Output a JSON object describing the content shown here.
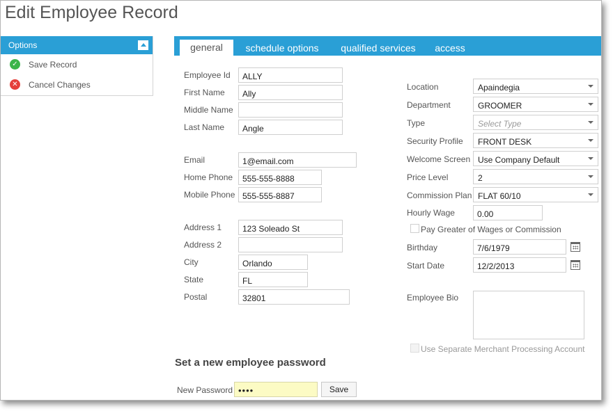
{
  "page": {
    "title": "Edit Employee Record"
  },
  "sidebar": {
    "header": "Options",
    "items": [
      {
        "label": "Save Record",
        "icon": "check-circle-icon"
      },
      {
        "label": "Cancel Changes",
        "icon": "x-circle-icon"
      }
    ]
  },
  "tabs": [
    {
      "label": "general",
      "active": true
    },
    {
      "label": "schedule options",
      "active": false
    },
    {
      "label": "qualified services",
      "active": false
    },
    {
      "label": "access",
      "active": false
    }
  ],
  "form": {
    "employee_id": {
      "label": "Employee Id",
      "value": "ALLY"
    },
    "first_name": {
      "label": "First Name",
      "value": "Ally"
    },
    "middle_name": {
      "label": "Middle Name",
      "value": ""
    },
    "last_name": {
      "label": "Last Name",
      "value": "Angle"
    },
    "email": {
      "label": "Email",
      "value": "1@email.com"
    },
    "home_phone": {
      "label": "Home Phone",
      "value": "555-555-8888"
    },
    "mobile_phone": {
      "label": "Mobile Phone",
      "value": "555-555-8887"
    },
    "address1": {
      "label": "Address 1",
      "value": "123 Soleado St"
    },
    "address2": {
      "label": "Address 2",
      "value": ""
    },
    "city": {
      "label": "City",
      "value": "Orlando"
    },
    "state": {
      "label": "State",
      "value": "FL"
    },
    "postal": {
      "label": "Postal",
      "value": "32801"
    },
    "location": {
      "label": "Location",
      "value": "Apaindegia"
    },
    "department": {
      "label": "Department",
      "value": "GROOMER"
    },
    "type": {
      "label": "Type",
      "placeholder": "Select Type"
    },
    "security_profile": {
      "label": "Security Profile",
      "value": "FRONT DESK"
    },
    "welcome_screen": {
      "label": "Welcome Screen",
      "value": "Use Company Default"
    },
    "price_level": {
      "label": "Price Level",
      "value": "2"
    },
    "commission_plan": {
      "label": "Commission Plan",
      "value": "FLAT 60/10"
    },
    "hourly_wage": {
      "label": "Hourly Wage",
      "value": "0.00"
    },
    "pay_greater": {
      "label": "Pay Greater of Wages or Commission",
      "checked": false
    },
    "birthday": {
      "label": "Birthday",
      "value": "7/6/1979"
    },
    "start_date": {
      "label": "Start Date",
      "value": "12/2/2013"
    },
    "employee_bio": {
      "label": "Employee Bio",
      "value": ""
    },
    "separate_merchant": {
      "label": "Use Separate Merchant Processing Account",
      "checked": false
    }
  },
  "password": {
    "section_title": "Set a new employee password",
    "label": "New Password",
    "value": "••••",
    "save_label": "Save"
  },
  "colors": {
    "accent": "#2a9fd6",
    "password_highlight": "#fcfbc4"
  }
}
